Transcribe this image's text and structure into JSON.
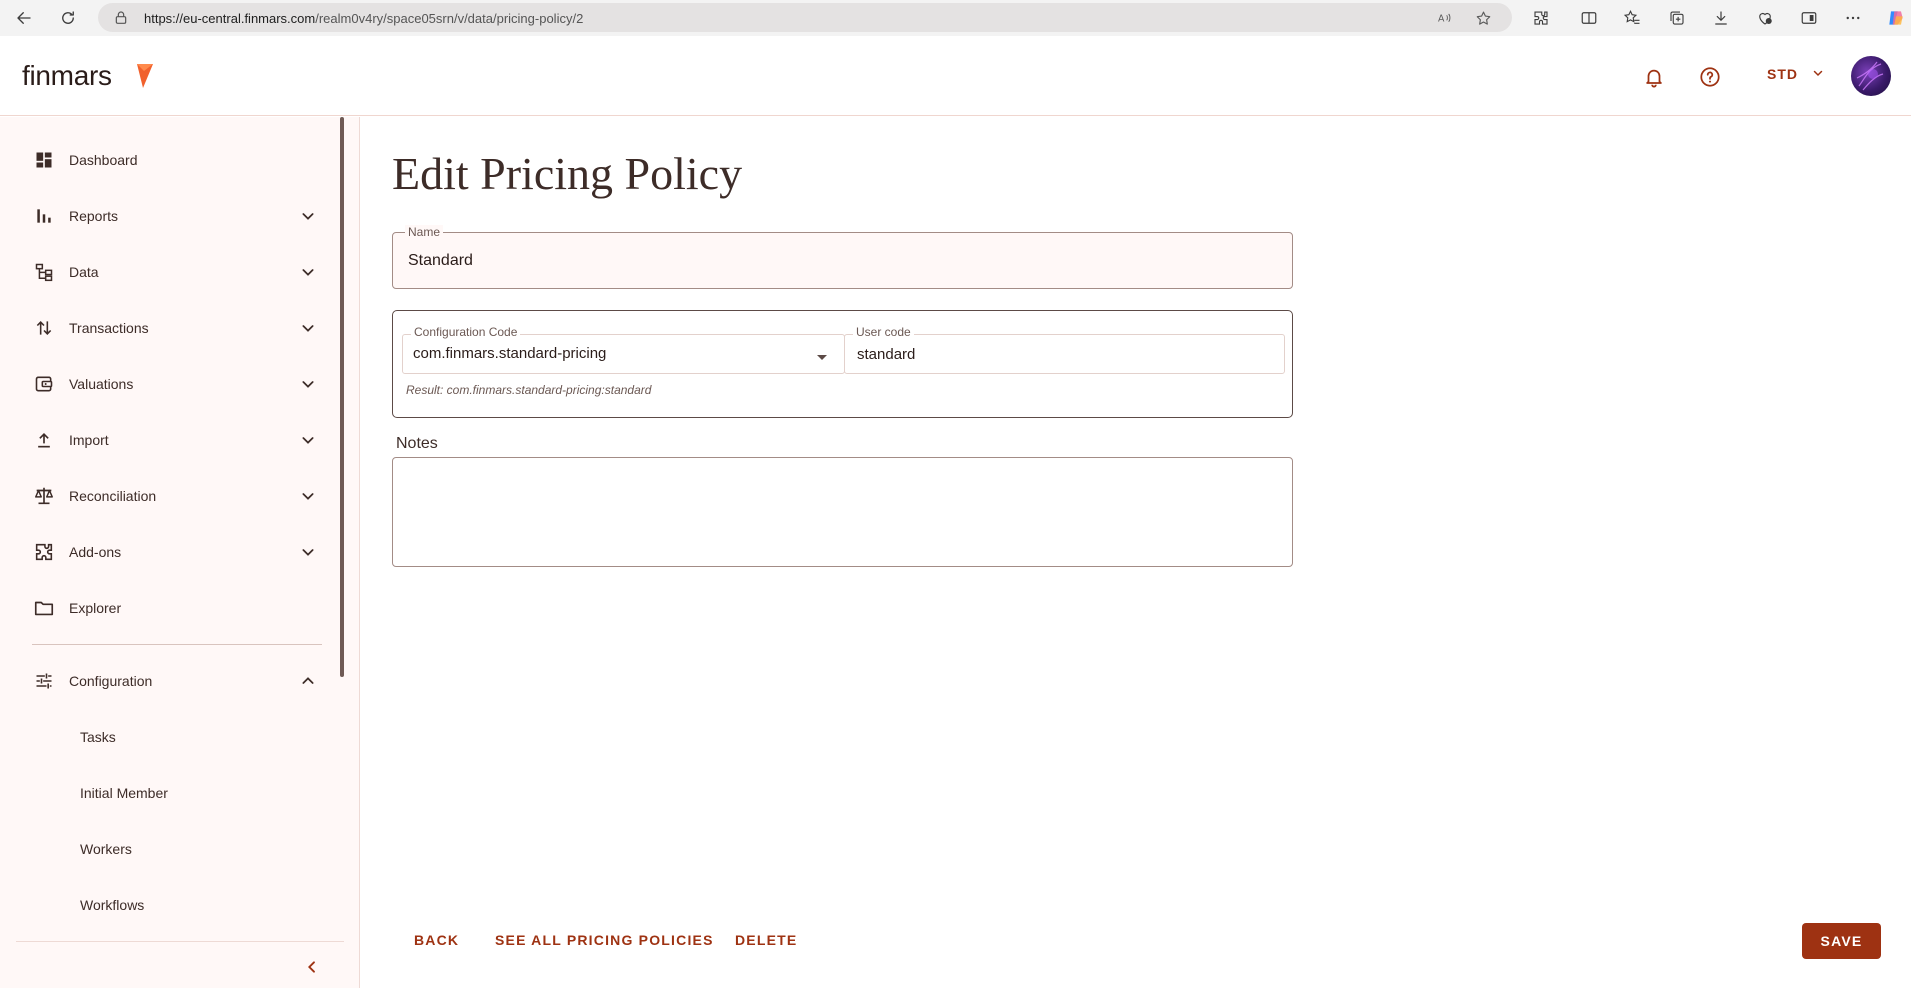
{
  "browser": {
    "url_host": "https://eu-central.finmars.com",
    "url_path": "/realm0v4ry/space05srn/v/data/pricing-policy/2"
  },
  "header": {
    "logo_text": "finmars",
    "workspace_label": "STD",
    "icons": [
      "bell-icon",
      "help-circle-icon",
      "chevron-down-icon"
    ],
    "accent_color": "#9e3212"
  },
  "sidebar": {
    "items": [
      {
        "label": "Dashboard",
        "icon": "dashboard-icon",
        "expandable": false
      },
      {
        "label": "Reports",
        "icon": "bar-chart-icon",
        "expandable": true
      },
      {
        "label": "Data",
        "icon": "tree-data-icon",
        "expandable": true
      },
      {
        "label": "Transactions",
        "icon": "swap-vertical-icon",
        "expandable": true
      },
      {
        "label": "Valuations",
        "icon": "wallet-icon",
        "expandable": true
      },
      {
        "label": "Import",
        "icon": "upload-icon",
        "expandable": true
      },
      {
        "label": "Reconciliation",
        "icon": "scale-icon",
        "expandable": true
      },
      {
        "label": "Add-ons",
        "icon": "puzzle-icon",
        "expandable": true
      },
      {
        "label": "Explorer",
        "icon": "folder-icon",
        "expandable": false
      }
    ],
    "configuration": {
      "label": "Configuration",
      "icon": "tune-icon",
      "expanded": true,
      "children": [
        "Tasks",
        "Initial Member",
        "Workers",
        "Workflows"
      ]
    }
  },
  "main": {
    "title": "Edit Pricing Policy",
    "name_field": {
      "label": "Name",
      "value": "Standard"
    },
    "configuration_code": {
      "label": "Configuration Code",
      "value": "com.finmars.standard-pricing"
    },
    "user_code": {
      "label": "User code",
      "value": "standard"
    },
    "result_text": "Result: com.finmars.standard-pricing:standard",
    "notes": {
      "label": "Notes",
      "value": ""
    },
    "actions": {
      "back": "BACK",
      "see_all": "SEE ALL PRICING POLICIES",
      "delete": "DELETE",
      "save": "SAVE"
    }
  }
}
